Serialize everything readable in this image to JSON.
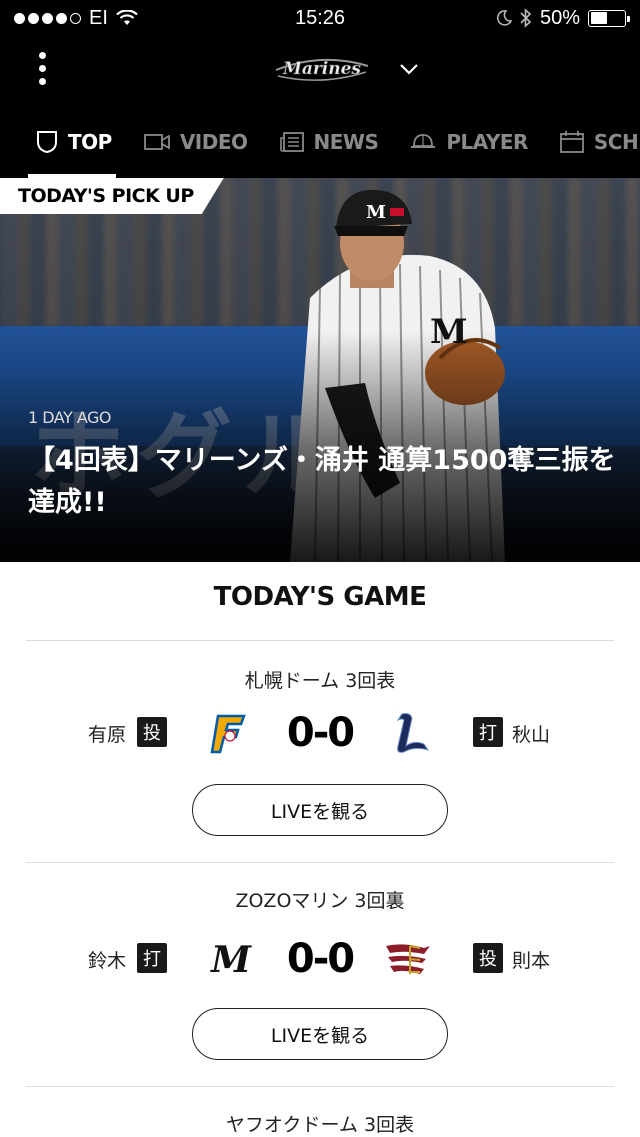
{
  "status": {
    "carrier": "EI",
    "time": "15:26",
    "battery": "50%",
    "battery_level": 0.5
  },
  "header": {
    "logo_text": "Marines"
  },
  "nav": [
    {
      "label": "TOP",
      "icon": "shield-icon",
      "active": true
    },
    {
      "label": "VIDEO",
      "icon": "video-camera-icon"
    },
    {
      "label": "NEWS",
      "icon": "newspaper-icon"
    },
    {
      "label": "PLAYER",
      "icon": "cap-icon"
    },
    {
      "label": "SCHEDULE",
      "icon": "calendar-icon"
    }
  ],
  "hero": {
    "badge": "TODAY'S PICK UP",
    "date": "1 DAY AGO",
    "title": "【4回表】マリーンズ・涌井 通算1500奪三振を達成!!"
  },
  "todays_game": {
    "title": "TODAY'S GAME",
    "games": [
      {
        "venue": "札幌ドーム 3回表",
        "left_player": "有原",
        "left_role": "投",
        "score": "0-0",
        "right_player": "秋山",
        "right_role": "打",
        "live_label": "LIVEを観る",
        "left_team_icon": "fighters-logo-icon",
        "right_team_icon": "lions-logo-icon"
      },
      {
        "venue": "ZOZOマリン 3回裏",
        "left_player": "鈴木",
        "left_role": "打",
        "score": "0-0",
        "right_player": "則本",
        "right_role": "投",
        "live_label": "LIVEを観る",
        "left_team_icon": "marines-logo-icon",
        "right_team_icon": "eagles-logo-icon"
      },
      {
        "venue": "ヤフオクドーム 3回表"
      }
    ]
  },
  "colors": {
    "header_bg": "#000000",
    "nav_inactive": "#8a8a8a",
    "accent": "#ffffff"
  }
}
